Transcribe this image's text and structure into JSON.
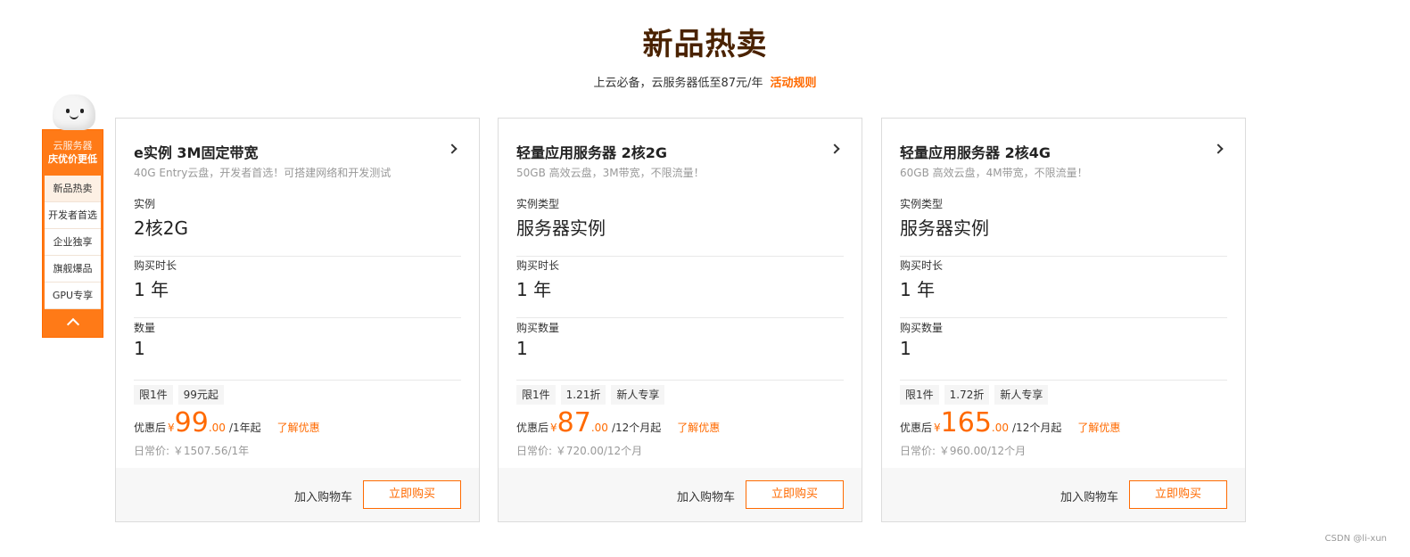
{
  "header": {
    "title": "新品热卖",
    "subtitle": "上云必备，云服务器低至87元/年",
    "rule_link": "活动规则"
  },
  "side_nav": {
    "head_line1": "云服务器",
    "head_line2": "庆优价更低",
    "items": [
      {
        "label": "新品热卖"
      },
      {
        "label": "开发者首选"
      },
      {
        "label": "企业独享"
      },
      {
        "label": "旗舰爆品"
      },
      {
        "label": "GPU专享"
      }
    ]
  },
  "cards": [
    {
      "title": "e实例 3M固定带宽",
      "desc": "40G Entry云盘，开发者首选！可搭建网络和开发测试",
      "fields": [
        {
          "label": "实例",
          "value": "2核2G"
        },
        {
          "label": "购买时长",
          "value": "1 年"
        },
        {
          "label": "数量",
          "value": "1"
        }
      ],
      "tags": [
        "限1件",
        "99元起"
      ],
      "price_prefix": "优惠后",
      "currency": "¥",
      "price_int": "99",
      "price_dec": ".00",
      "price_unit": "/1年起",
      "know_more": "了解优惠",
      "orig_price": "日常价: ￥1507.56/1年",
      "add_cart": "加入购物车",
      "buy": "立即购买"
    },
    {
      "title": "轻量应用服务器 2核2G",
      "desc": "50GB 高效云盘，3M带宽，不限流量！",
      "fields": [
        {
          "label": "实例类型",
          "value": "服务器实例"
        },
        {
          "label": "购买时长",
          "value": "1 年"
        },
        {
          "label": "购买数量",
          "value": "1"
        }
      ],
      "tags": [
        "限1件",
        "1.21折",
        "新人专享"
      ],
      "price_prefix": "优惠后",
      "currency": "¥",
      "price_int": "87",
      "price_dec": ".00",
      "price_unit": "/12个月起",
      "know_more": "了解优惠",
      "orig_price": "日常价: ￥720.00/12个月",
      "add_cart": "加入购物车",
      "buy": "立即购买"
    },
    {
      "title": "轻量应用服务器 2核4G",
      "desc": "60GB 高效云盘，4M带宽，不限流量！",
      "fields": [
        {
          "label": "实例类型",
          "value": "服务器实例"
        },
        {
          "label": "购买时长",
          "value": "1 年"
        },
        {
          "label": "购买数量",
          "value": "1"
        }
      ],
      "tags": [
        "限1件",
        "1.72折",
        "新人专享"
      ],
      "price_prefix": "优惠后",
      "currency": "¥",
      "price_int": "165",
      "price_dec": ".00",
      "price_unit": "/12个月起",
      "know_more": "了解优惠",
      "orig_price": "日常价: ￥960.00/12个月",
      "add_cart": "加入购物车",
      "buy": "立即购买"
    }
  ],
  "watermark": "CSDN @li-xun",
  "colors": {
    "accent": "#ff6a00",
    "title": "#4a2200"
  }
}
